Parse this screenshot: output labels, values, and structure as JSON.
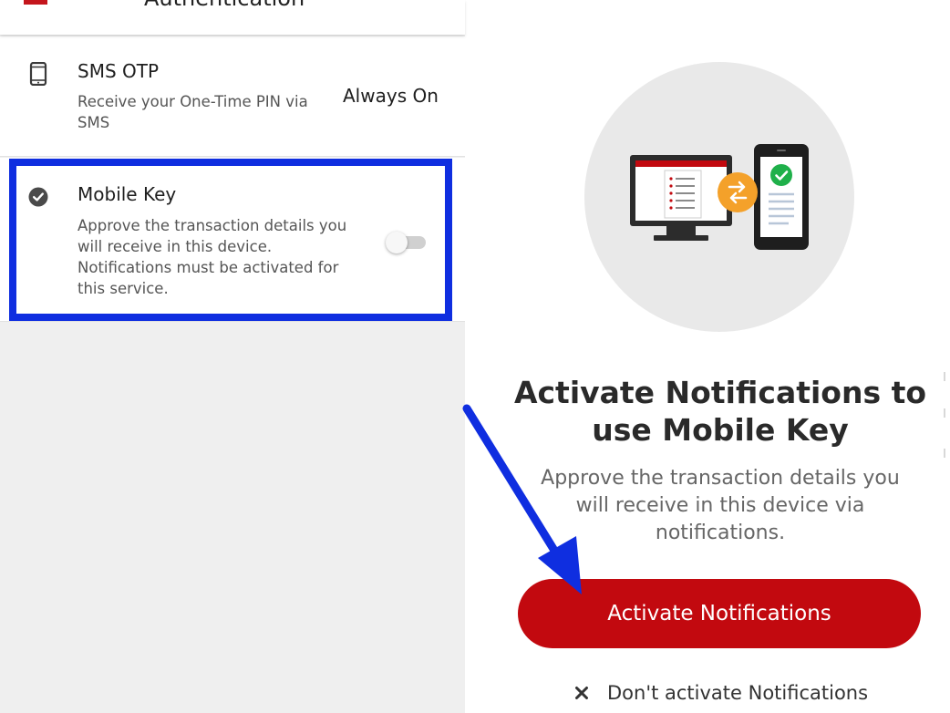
{
  "top_bar": {
    "title": "Authentication"
  },
  "sms_otp": {
    "title": "SMS OTP",
    "description": "Receive your One-Time PIN via SMS",
    "status": "Always On",
    "icon": "phone-icon"
  },
  "mobile_key": {
    "title": "Mobile Key",
    "description": "Approve the transaction details you will receive in this device. Notifications must be activated for this service.",
    "toggle_on": false,
    "icon": "check-circle-icon"
  },
  "activation": {
    "heading": "Activate Notifications to use Mobile Key",
    "subtext": "Approve the transaction details you will receive in this device via notifications.",
    "activate_button": "Activate Notifications",
    "dont_activate": "Don't activate Notifications"
  },
  "colors": {
    "brand_red": "#c2090f",
    "highlight_blue": "#0f2ee0",
    "success_green": "#1fb04a",
    "swap_orange": "#f4a12a"
  }
}
